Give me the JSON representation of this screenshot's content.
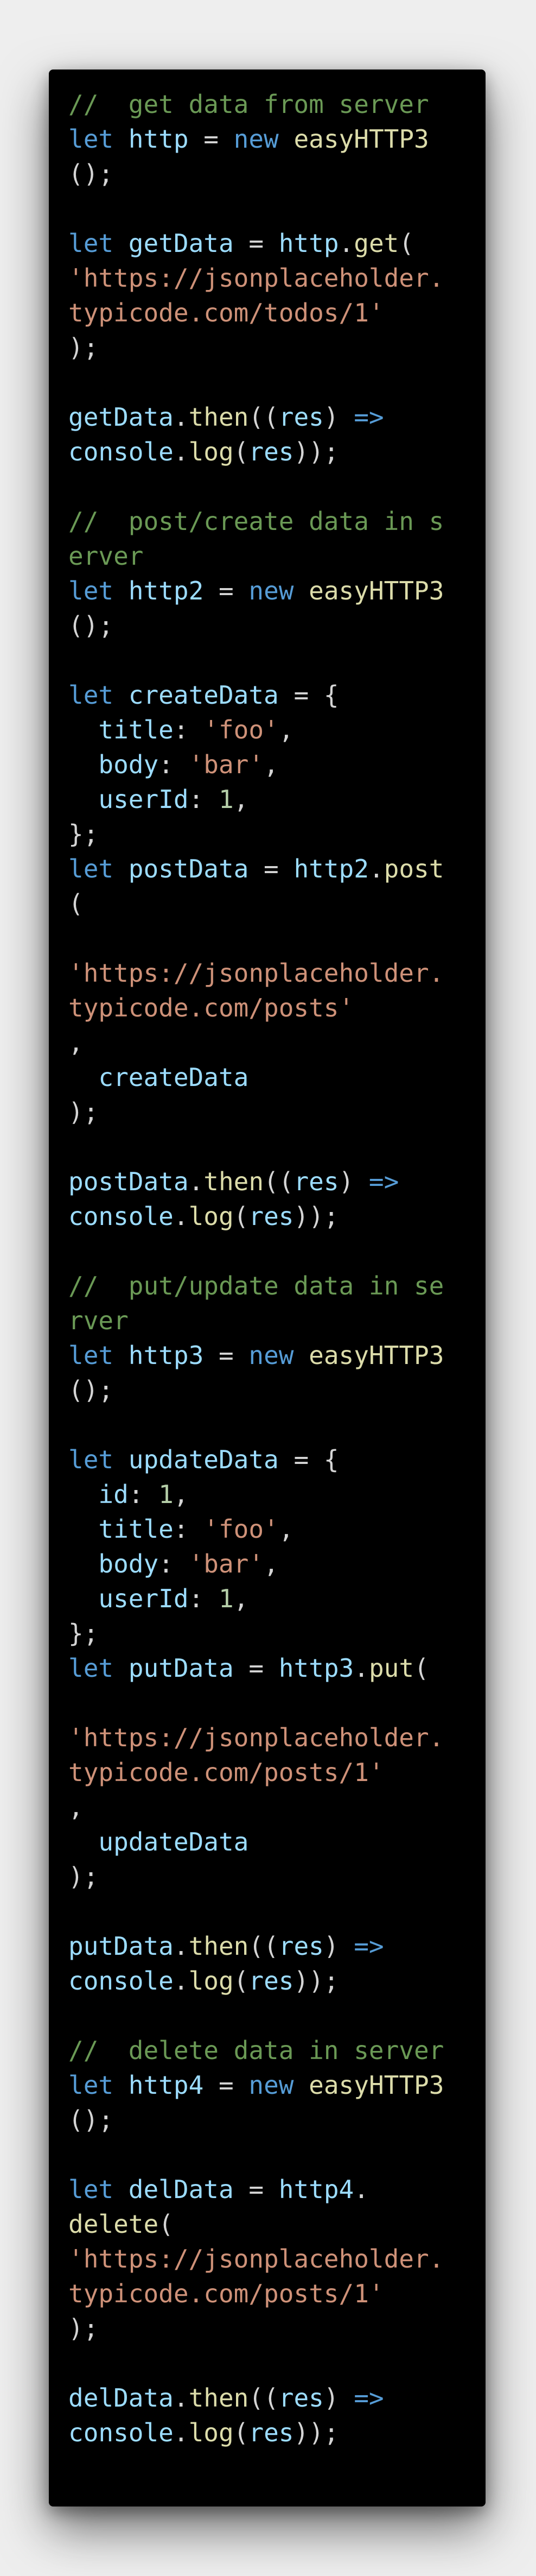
{
  "editor": {
    "background": "#000000",
    "lines": [
      [
        {
          "t": "//  get data from server",
          "c": "comment"
        }
      ],
      [
        {
          "t": "let",
          "c": "kw"
        },
        {
          "t": " ",
          "c": "punc"
        },
        {
          "t": "http",
          "c": "var"
        },
        {
          "t": " = ",
          "c": "punc"
        },
        {
          "t": "new",
          "c": "kw"
        },
        {
          "t": " ",
          "c": "punc"
        },
        {
          "t": "easyHTTP3",
          "c": "fn"
        }
      ],
      [
        {
          "t": "();",
          "c": "punc"
        }
      ],
      [],
      [
        {
          "t": "let",
          "c": "kw"
        },
        {
          "t": " ",
          "c": "punc"
        },
        {
          "t": "getData",
          "c": "var"
        },
        {
          "t": " = ",
          "c": "punc"
        },
        {
          "t": "http",
          "c": "var"
        },
        {
          "t": ".",
          "c": "punc"
        },
        {
          "t": "get",
          "c": "fn"
        },
        {
          "t": "(",
          "c": "punc"
        }
      ],
      [
        {
          "t": "'https://jsonplaceholder.",
          "c": "str"
        }
      ],
      [
        {
          "t": "typicode.com/todos/1'",
          "c": "str"
        }
      ],
      [
        {
          "t": ");",
          "c": "punc"
        }
      ],
      [],
      [
        {
          "t": "getData",
          "c": "var"
        },
        {
          "t": ".",
          "c": "punc"
        },
        {
          "t": "then",
          "c": "fn"
        },
        {
          "t": "((",
          "c": "punc"
        },
        {
          "t": "res",
          "c": "var"
        },
        {
          "t": ") ",
          "c": "punc"
        },
        {
          "t": "=>",
          "c": "kw"
        }
      ],
      [
        {
          "t": "console",
          "c": "var"
        },
        {
          "t": ".",
          "c": "punc"
        },
        {
          "t": "log",
          "c": "fn"
        },
        {
          "t": "(",
          "c": "punc"
        },
        {
          "t": "res",
          "c": "var"
        },
        {
          "t": "));",
          "c": "punc"
        }
      ],
      [],
      [
        {
          "t": "//  post/create data in s",
          "c": "comment"
        }
      ],
      [
        {
          "t": "erver",
          "c": "comment"
        }
      ],
      [
        {
          "t": "let",
          "c": "kw"
        },
        {
          "t": " ",
          "c": "punc"
        },
        {
          "t": "http2",
          "c": "var"
        },
        {
          "t": " = ",
          "c": "punc"
        },
        {
          "t": "new",
          "c": "kw"
        },
        {
          "t": " ",
          "c": "punc"
        },
        {
          "t": "easyHTTP3",
          "c": "fn"
        }
      ],
      [
        {
          "t": "();",
          "c": "punc"
        }
      ],
      [],
      [
        {
          "t": "let",
          "c": "kw"
        },
        {
          "t": " ",
          "c": "punc"
        },
        {
          "t": "createData",
          "c": "var"
        },
        {
          "t": " = {",
          "c": "punc"
        }
      ],
      [
        {
          "t": "  ",
          "c": "punc"
        },
        {
          "t": "title",
          "c": "var"
        },
        {
          "t": ": ",
          "c": "punc"
        },
        {
          "t": "'foo'",
          "c": "str"
        },
        {
          "t": ",",
          "c": "punc"
        }
      ],
      [
        {
          "t": "  ",
          "c": "punc"
        },
        {
          "t": "body",
          "c": "var"
        },
        {
          "t": ": ",
          "c": "punc"
        },
        {
          "t": "'bar'",
          "c": "str"
        },
        {
          "t": ",",
          "c": "punc"
        }
      ],
      [
        {
          "t": "  ",
          "c": "punc"
        },
        {
          "t": "userId",
          "c": "var"
        },
        {
          "t": ": ",
          "c": "punc"
        },
        {
          "t": "1",
          "c": "num"
        },
        {
          "t": ",",
          "c": "punc"
        }
      ],
      [
        {
          "t": "};",
          "c": "punc"
        }
      ],
      [
        {
          "t": "let",
          "c": "kw"
        },
        {
          "t": " ",
          "c": "punc"
        },
        {
          "t": "postData",
          "c": "var"
        },
        {
          "t": " = ",
          "c": "punc"
        },
        {
          "t": "http2",
          "c": "var"
        },
        {
          "t": ".",
          "c": "punc"
        },
        {
          "t": "post",
          "c": "fn"
        }
      ],
      [
        {
          "t": "(",
          "c": "punc"
        }
      ],
      [],
      [
        {
          "t": "'https://jsonplaceholder.",
          "c": "str"
        }
      ],
      [
        {
          "t": "typicode.com/posts'",
          "c": "str"
        }
      ],
      [
        {
          "t": ",",
          "c": "punc"
        }
      ],
      [
        {
          "t": "  ",
          "c": "punc"
        },
        {
          "t": "createData",
          "c": "var"
        }
      ],
      [
        {
          "t": ");",
          "c": "punc"
        }
      ],
      [],
      [
        {
          "t": "postData",
          "c": "var"
        },
        {
          "t": ".",
          "c": "punc"
        },
        {
          "t": "then",
          "c": "fn"
        },
        {
          "t": "((",
          "c": "punc"
        },
        {
          "t": "res",
          "c": "var"
        },
        {
          "t": ") ",
          "c": "punc"
        },
        {
          "t": "=>",
          "c": "kw"
        }
      ],
      [
        {
          "t": "console",
          "c": "var"
        },
        {
          "t": ".",
          "c": "punc"
        },
        {
          "t": "log",
          "c": "fn"
        },
        {
          "t": "(",
          "c": "punc"
        },
        {
          "t": "res",
          "c": "var"
        },
        {
          "t": "));",
          "c": "punc"
        }
      ],
      [],
      [
        {
          "t": "//  put/update data in se",
          "c": "comment"
        }
      ],
      [
        {
          "t": "rver",
          "c": "comment"
        }
      ],
      [
        {
          "t": "let",
          "c": "kw"
        },
        {
          "t": " ",
          "c": "punc"
        },
        {
          "t": "http3",
          "c": "var"
        },
        {
          "t": " = ",
          "c": "punc"
        },
        {
          "t": "new",
          "c": "kw"
        },
        {
          "t": " ",
          "c": "punc"
        },
        {
          "t": "easyHTTP3",
          "c": "fn"
        }
      ],
      [
        {
          "t": "();",
          "c": "punc"
        }
      ],
      [],
      [
        {
          "t": "let",
          "c": "kw"
        },
        {
          "t": " ",
          "c": "punc"
        },
        {
          "t": "updateData",
          "c": "var"
        },
        {
          "t": " = {",
          "c": "punc"
        }
      ],
      [
        {
          "t": "  ",
          "c": "punc"
        },
        {
          "t": "id",
          "c": "var"
        },
        {
          "t": ": ",
          "c": "punc"
        },
        {
          "t": "1",
          "c": "num"
        },
        {
          "t": ",",
          "c": "punc"
        }
      ],
      [
        {
          "t": "  ",
          "c": "punc"
        },
        {
          "t": "title",
          "c": "var"
        },
        {
          "t": ": ",
          "c": "punc"
        },
        {
          "t": "'foo'",
          "c": "str"
        },
        {
          "t": ",",
          "c": "punc"
        }
      ],
      [
        {
          "t": "  ",
          "c": "punc"
        },
        {
          "t": "body",
          "c": "var"
        },
        {
          "t": ": ",
          "c": "punc"
        },
        {
          "t": "'bar'",
          "c": "str"
        },
        {
          "t": ",",
          "c": "punc"
        }
      ],
      [
        {
          "t": "  ",
          "c": "punc"
        },
        {
          "t": "userId",
          "c": "var"
        },
        {
          "t": ": ",
          "c": "punc"
        },
        {
          "t": "1",
          "c": "num"
        },
        {
          "t": ",",
          "c": "punc"
        }
      ],
      [
        {
          "t": "};",
          "c": "punc"
        }
      ],
      [
        {
          "t": "let",
          "c": "kw"
        },
        {
          "t": " ",
          "c": "punc"
        },
        {
          "t": "putData",
          "c": "var"
        },
        {
          "t": " = ",
          "c": "punc"
        },
        {
          "t": "http3",
          "c": "var"
        },
        {
          "t": ".",
          "c": "punc"
        },
        {
          "t": "put",
          "c": "fn"
        },
        {
          "t": "(",
          "c": "punc"
        }
      ],
      [],
      [
        {
          "t": "'https://jsonplaceholder.",
          "c": "str"
        }
      ],
      [
        {
          "t": "typicode.com/posts/1'",
          "c": "str"
        }
      ],
      [
        {
          "t": ",",
          "c": "punc"
        }
      ],
      [
        {
          "t": "  ",
          "c": "punc"
        },
        {
          "t": "updateData",
          "c": "var"
        }
      ],
      [
        {
          "t": ");",
          "c": "punc"
        }
      ],
      [],
      [
        {
          "t": "putData",
          "c": "var"
        },
        {
          "t": ".",
          "c": "punc"
        },
        {
          "t": "then",
          "c": "fn"
        },
        {
          "t": "((",
          "c": "punc"
        },
        {
          "t": "res",
          "c": "var"
        },
        {
          "t": ") ",
          "c": "punc"
        },
        {
          "t": "=>",
          "c": "kw"
        }
      ],
      [
        {
          "t": "console",
          "c": "var"
        },
        {
          "t": ".",
          "c": "punc"
        },
        {
          "t": "log",
          "c": "fn"
        },
        {
          "t": "(",
          "c": "punc"
        },
        {
          "t": "res",
          "c": "var"
        },
        {
          "t": "));",
          "c": "punc"
        }
      ],
      [],
      [
        {
          "t": "//  delete data in server",
          "c": "comment"
        }
      ],
      [
        {
          "t": "let",
          "c": "kw"
        },
        {
          "t": " ",
          "c": "punc"
        },
        {
          "t": "http4",
          "c": "var"
        },
        {
          "t": " = ",
          "c": "punc"
        },
        {
          "t": "new",
          "c": "kw"
        },
        {
          "t": " ",
          "c": "punc"
        },
        {
          "t": "easyHTTP3",
          "c": "fn"
        }
      ],
      [
        {
          "t": "();",
          "c": "punc"
        }
      ],
      [],
      [
        {
          "t": "let",
          "c": "kw"
        },
        {
          "t": " ",
          "c": "punc"
        },
        {
          "t": "delData",
          "c": "var"
        },
        {
          "t": " = ",
          "c": "punc"
        },
        {
          "t": "http4",
          "c": "var"
        },
        {
          "t": ".",
          "c": "punc"
        }
      ],
      [
        {
          "t": "delete",
          "c": "fn"
        },
        {
          "t": "(",
          "c": "punc"
        }
      ],
      [
        {
          "t": "'https://jsonplaceholder.",
          "c": "str"
        }
      ],
      [
        {
          "t": "typicode.com/posts/1'",
          "c": "str"
        }
      ],
      [
        {
          "t": ");",
          "c": "punc"
        }
      ],
      [],
      [
        {
          "t": "delData",
          "c": "var"
        },
        {
          "t": ".",
          "c": "punc"
        },
        {
          "t": "then",
          "c": "fn"
        },
        {
          "t": "((",
          "c": "punc"
        },
        {
          "t": "res",
          "c": "var"
        },
        {
          "t": ") ",
          "c": "punc"
        },
        {
          "t": "=>",
          "c": "kw"
        }
      ],
      [
        {
          "t": "console",
          "c": "var"
        },
        {
          "t": ".",
          "c": "punc"
        },
        {
          "t": "log",
          "c": "fn"
        },
        {
          "t": "(",
          "c": "punc"
        },
        {
          "t": "res",
          "c": "var"
        },
        {
          "t": "));",
          "c": "punc"
        }
      ]
    ]
  }
}
